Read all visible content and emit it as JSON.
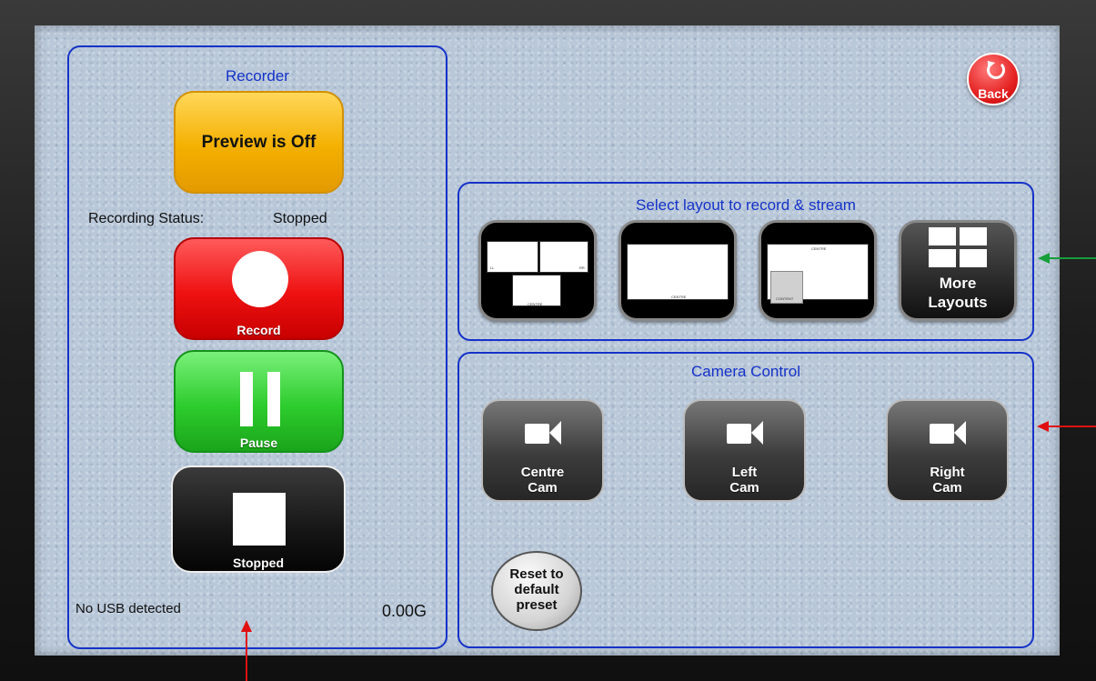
{
  "recorder": {
    "title": "Recorder",
    "preview_button": "Preview is Off",
    "status_label": "Recording Status:",
    "status_value": "Stopped",
    "record_label": "Record",
    "pause_label": "Pause",
    "stop_label": "Stopped",
    "usb_status": "No USB detected",
    "storage": "0.00G"
  },
  "back_button": {
    "label": "Back"
  },
  "layouts": {
    "title": "Select layout to record & stream",
    "thumb_label_a": "CENTRE",
    "thumb_label_content": "CONTENT",
    "thumb_label_l": "LL",
    "thumb_label_r": "RR",
    "more_label_line1": "More",
    "more_label_line2": "Layouts"
  },
  "camera": {
    "title": "Camera Control",
    "cams": [
      {
        "line1": "Centre",
        "line2": "Cam"
      },
      {
        "line1": "Left",
        "line2": "Cam"
      },
      {
        "line1": "Right",
        "line2": "Cam"
      }
    ],
    "reset_line1": "Reset to",
    "reset_line2": "default",
    "reset_line3": "preset"
  },
  "colors": {
    "panel_border": "#1532c8",
    "annotation_green": "#169e3a",
    "annotation_red": "#e01010"
  }
}
